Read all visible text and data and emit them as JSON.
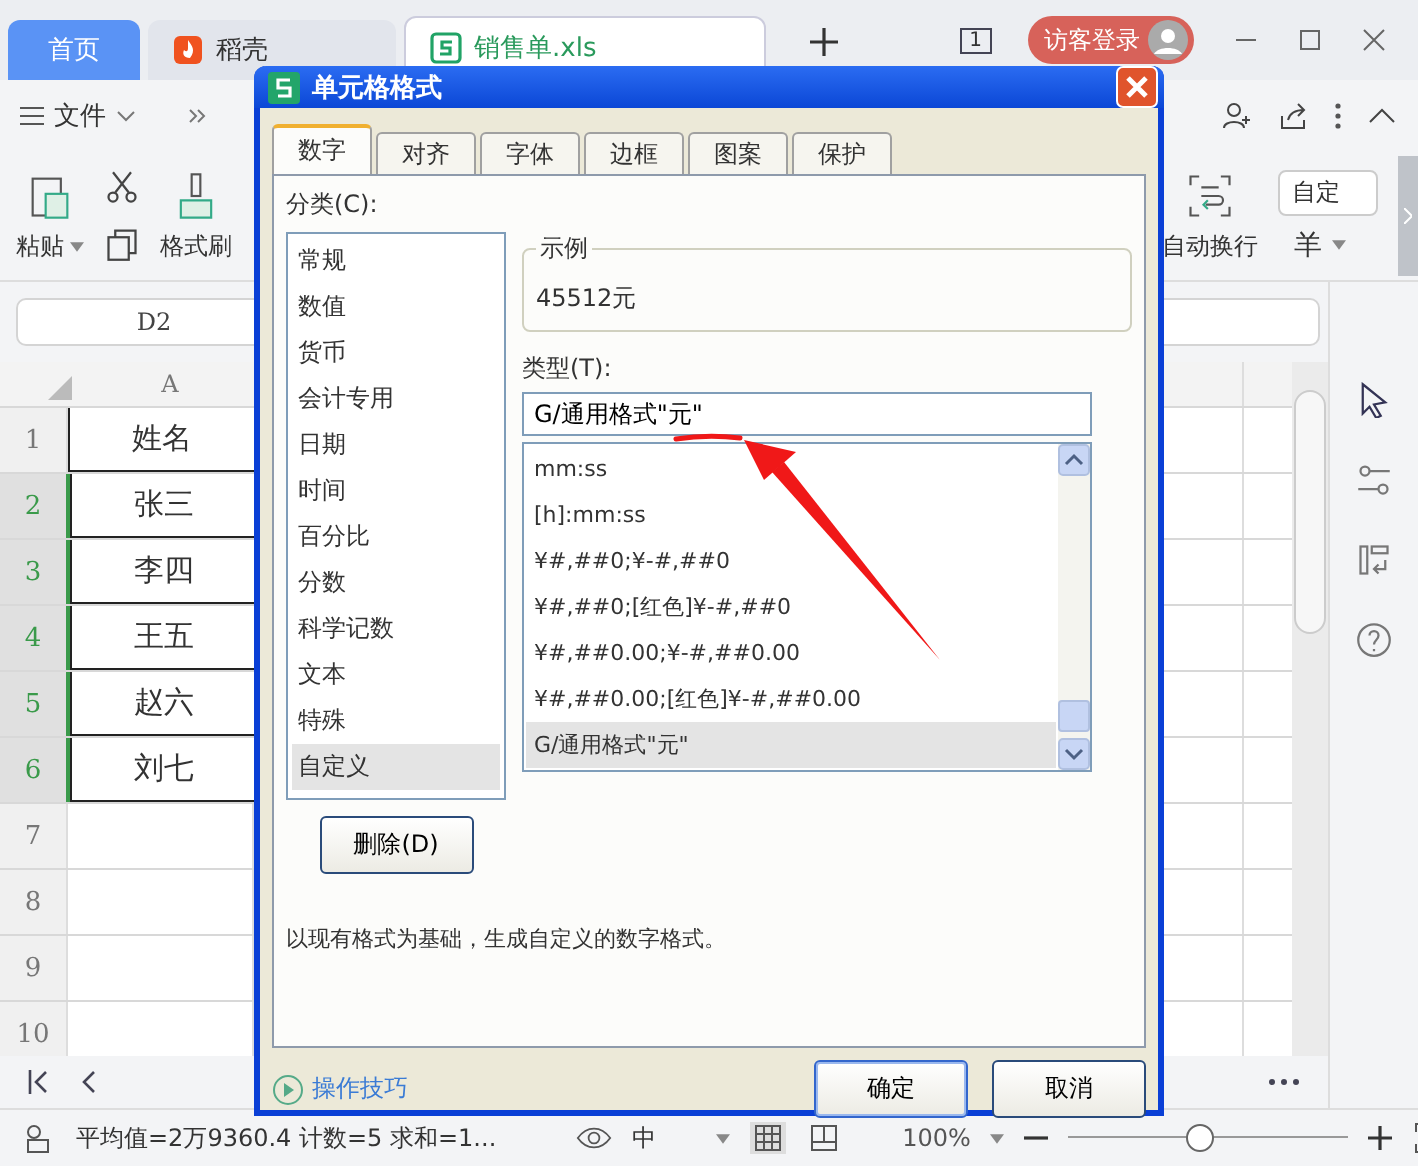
{
  "app_tabs": [
    {
      "label": "首页",
      "kind": "home",
      "selected": false
    },
    {
      "label": "稻壳",
      "kind": "docer",
      "selected": false
    },
    {
      "label": "销售单.xls",
      "kind": "file",
      "selected": true
    }
  ],
  "window_controls": {
    "badge": "1",
    "login": "访客登录"
  },
  "menu": {
    "file": "文件"
  },
  "ribbon": {
    "paste": "粘贴",
    "format_painter": "格式刷",
    "wrap": "自动换行",
    "number_format": "自定",
    "currency": "羊"
  },
  "name_box": "D2",
  "sheet": {
    "column": "A",
    "rows": [
      {
        "number": "1",
        "value": "姓名",
        "selected": false
      },
      {
        "number": "2",
        "value": "张三",
        "selected": true
      },
      {
        "number": "3",
        "value": "李四",
        "selected": true
      },
      {
        "number": "4",
        "value": "王五",
        "selected": true
      },
      {
        "number": "5",
        "value": "赵六",
        "selected": true
      },
      {
        "number": "6",
        "value": "刘七",
        "selected": true
      },
      {
        "number": "7",
        "value": "",
        "selected": false
      },
      {
        "number": "8",
        "value": "",
        "selected": false
      },
      {
        "number": "9",
        "value": "",
        "selected": false
      },
      {
        "number": "10",
        "value": "",
        "selected": false
      }
    ]
  },
  "dialog": {
    "title": "单元格格式",
    "tabs": [
      {
        "label": "数字",
        "selected": true
      },
      {
        "label": "对齐",
        "selected": false
      },
      {
        "label": "字体",
        "selected": false
      },
      {
        "label": "边框",
        "selected": false
      },
      {
        "label": "图案",
        "selected": false
      },
      {
        "label": "保护",
        "selected": false
      }
    ],
    "category_label": "分类(C):",
    "categories": [
      {
        "label": "常规",
        "selected": false
      },
      {
        "label": "数值",
        "selected": false
      },
      {
        "label": "货币",
        "selected": false
      },
      {
        "label": "会计专用",
        "selected": false
      },
      {
        "label": "日期",
        "selected": false
      },
      {
        "label": "时间",
        "selected": false
      },
      {
        "label": "百分比",
        "selected": false
      },
      {
        "label": "分数",
        "selected": false
      },
      {
        "label": "科学记数",
        "selected": false
      },
      {
        "label": "文本",
        "selected": false
      },
      {
        "label": "特殊",
        "selected": false
      },
      {
        "label": "自定义",
        "selected": true
      }
    ],
    "delete_button": "删除(D)",
    "sample_label": "示例",
    "sample_value": "45512元",
    "type_label": "类型(T):",
    "type_value": "G/通用格式\"元\"",
    "formats": [
      {
        "label": "mm:ss",
        "selected": false
      },
      {
        "label": "[h]:mm:ss",
        "selected": false
      },
      {
        "label": "¥#,##0;¥-#,##0",
        "selected": false
      },
      {
        "label": "¥#,##0;[红色]¥-#,##0",
        "selected": false
      },
      {
        "label": "¥#,##0.00;¥-#,##0.00",
        "selected": false
      },
      {
        "label": "¥#,##0.00;[红色]¥-#,##0.00",
        "selected": false
      },
      {
        "label": "G/通用格式\"元\"",
        "selected": true
      }
    ],
    "description": "以现有格式为基础，生成自定义的数字格式。",
    "tips_link": "操作技巧",
    "ok": "确定",
    "cancel": "取消"
  },
  "status_bar": {
    "stats": "平均值=2万9360.4  计数=5  求和=1...",
    "ime": "中",
    "zoom": "100%",
    "zoom_slider": {
      "level": 0.47
    }
  }
}
